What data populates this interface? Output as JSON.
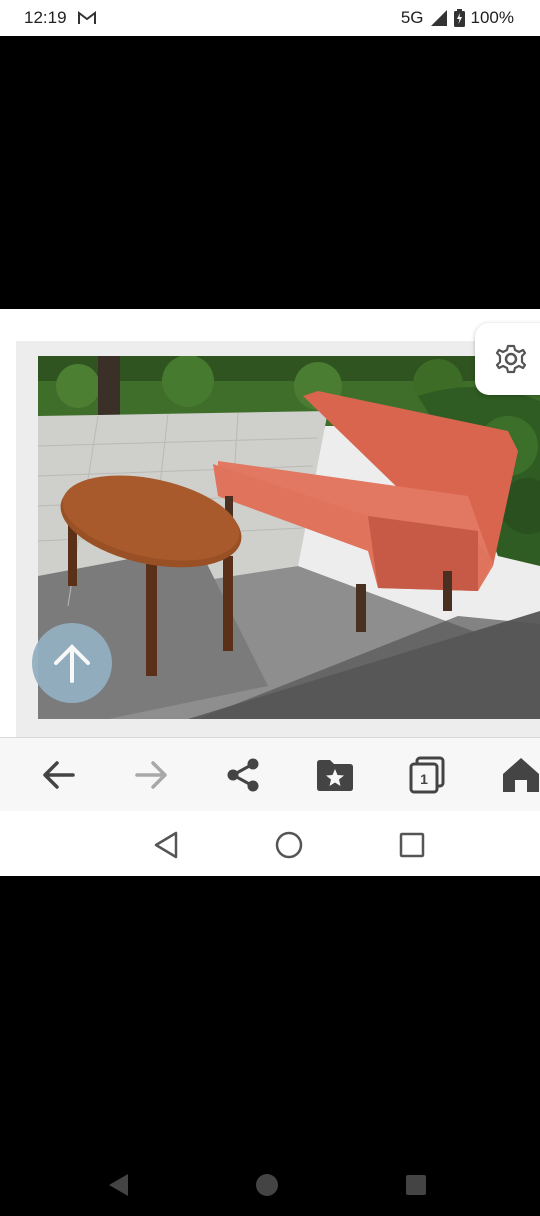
{
  "status_bar": {
    "time": "12:19",
    "notification_icon": "gmail-icon",
    "network": "5G",
    "signal_icon": "signal-icon",
    "battery_icon": "battery-charging-icon",
    "battery_percent": "100%"
  },
  "page": {
    "image_description_icon": "sofa-and-table-photo",
    "scroll_top_icon": "arrow-up-icon",
    "settings_icon": "gear-icon"
  },
  "toolbar": {
    "buttons": [
      {
        "name": "back",
        "icon": "arrow-left-icon"
      },
      {
        "name": "forward",
        "icon": "arrow-right-icon"
      },
      {
        "name": "share",
        "icon": "share-icon"
      },
      {
        "name": "bookmarks",
        "icon": "bookmark-folder-icon"
      },
      {
        "name": "tabs",
        "icon": "tabs-icon",
        "count": "1"
      },
      {
        "name": "home",
        "icon": "home-icon"
      }
    ]
  },
  "system_nav": {
    "back_icon": "triangle-back-icon",
    "home_icon": "circle-home-icon",
    "recents_icon": "square-recents-icon"
  },
  "colors": {
    "sofa": "#e0735c",
    "table": "#9a5025",
    "scroll_button": "#93afc0"
  }
}
